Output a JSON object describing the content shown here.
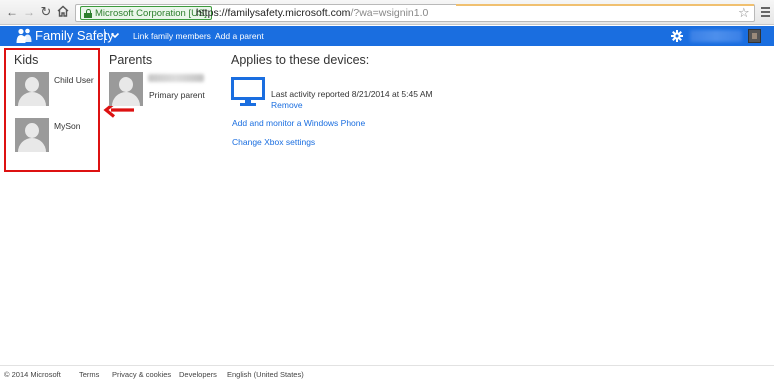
{
  "browser": {
    "back_icon": "arrow-left-icon",
    "forward_icon": "arrow-right-icon",
    "reload_icon": "reload-icon",
    "home_icon": "home-icon",
    "ev_certificate": "Microsoft Corporation [US]",
    "url_main": "https://familysafety.microsoft.com",
    "url_rest": "/?wa=wsignin1.0",
    "bookmark_icon": "star-icon",
    "menu_icon": "hamburger-menu-icon"
  },
  "header": {
    "app_title": "Family Safety",
    "nav_links": [
      "Link family members",
      "Add a parent"
    ],
    "settings_icon": "gear-icon",
    "brand_color": "#1a6ee0"
  },
  "kids": {
    "heading": "Kids",
    "members": [
      {
        "name": "Child User"
      },
      {
        "name": "MySon"
      }
    ]
  },
  "parents": {
    "heading": "Parents",
    "members": [
      {
        "role": "Primary parent"
      }
    ]
  },
  "devices": {
    "heading": "Applies to these devices:",
    "items": [
      {
        "activity": "Last activity reported 8/21/2014 at 5:45 AM",
        "remove_label": "Remove"
      }
    ],
    "links": [
      "Add and monitor a Windows Phone",
      "Change Xbox settings"
    ]
  },
  "annotation": {
    "highlight_color": "#dd1111"
  },
  "footer": {
    "copyright": "© 2014 Microsoft",
    "links": [
      "Terms",
      "Privacy & cookies",
      "Developers",
      "English (United States)"
    ]
  }
}
